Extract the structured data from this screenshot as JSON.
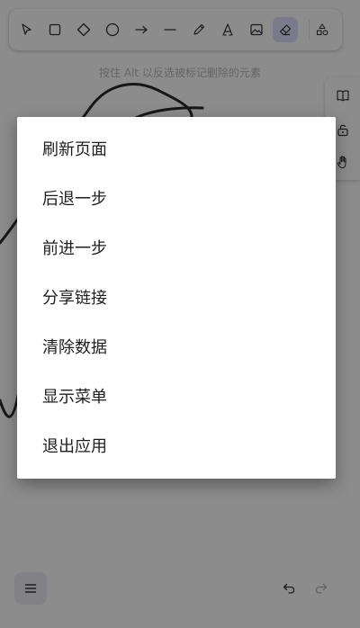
{
  "toolbar": {
    "tools": [
      {
        "name": "selection-tool",
        "icon": "cursor-icon"
      },
      {
        "name": "rectangle-tool",
        "icon": "square-icon"
      },
      {
        "name": "diamond-tool",
        "icon": "diamond-icon"
      },
      {
        "name": "ellipse-tool",
        "icon": "circle-icon"
      },
      {
        "name": "arrow-tool",
        "icon": "arrow-right-icon"
      },
      {
        "name": "line-tool",
        "icon": "line-icon"
      },
      {
        "name": "draw-tool",
        "icon": "pencil-icon"
      },
      {
        "name": "text-tool",
        "icon": "text-icon"
      },
      {
        "name": "image-tool",
        "icon": "image-icon"
      },
      {
        "name": "eraser-tool",
        "icon": "eraser-icon",
        "active": true
      },
      {
        "name": "more-shapes-tool",
        "icon": "shapes-icon"
      }
    ],
    "active_color": "#e0dfff"
  },
  "hint": {
    "text": "按住 Alt 以反选被标记删除的元素"
  },
  "side_panel": {
    "buttons": [
      "library-icon",
      "unlock-icon",
      "hand-icon"
    ]
  },
  "bottom_bar": {
    "menu_icon": "hamburger-icon",
    "undo_icon": "undo-icon",
    "redo_icon": "redo-icon"
  },
  "context_menu": {
    "items": [
      {
        "label": "刷新页面"
      },
      {
        "label": "后退一步"
      },
      {
        "label": "前进一步"
      },
      {
        "label": "分享链接"
      },
      {
        "label": "清除数据"
      },
      {
        "label": "显示菜单"
      },
      {
        "label": "退出应用"
      }
    ]
  }
}
